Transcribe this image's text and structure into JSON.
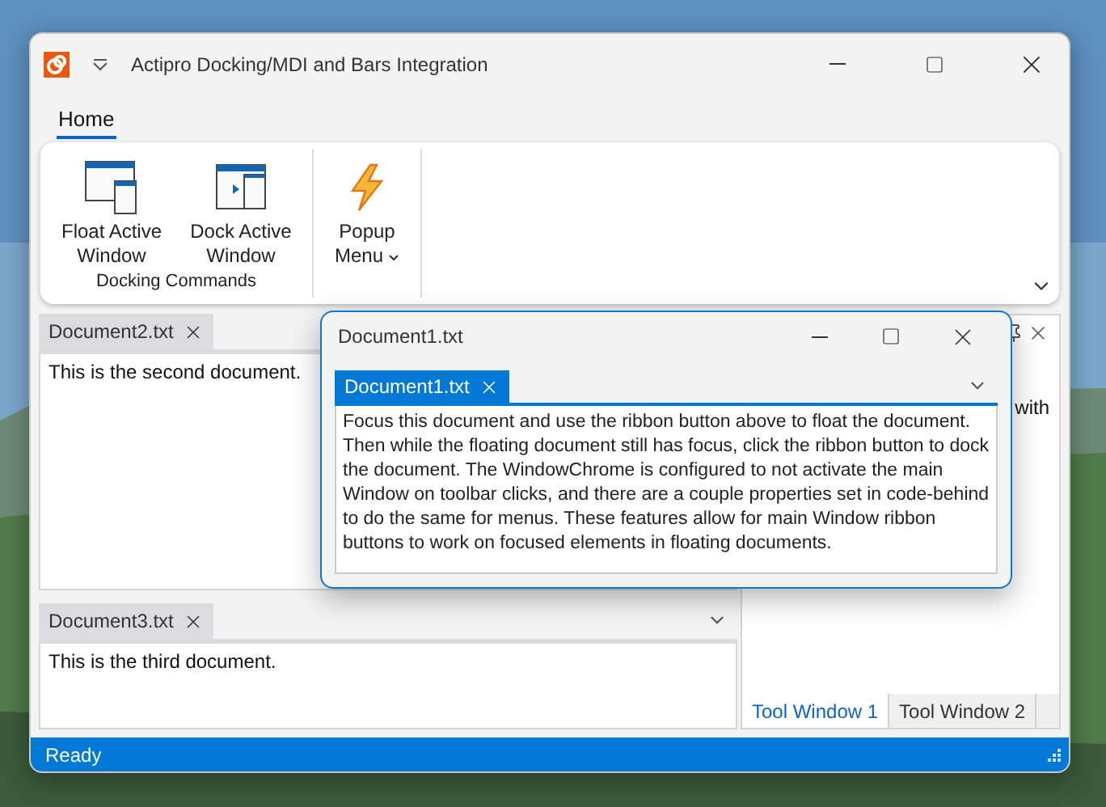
{
  "window": {
    "title": "Actipro Docking/MDI and Bars Integration"
  },
  "ribbon": {
    "tabs": [
      {
        "label": "Home",
        "selected": true
      }
    ],
    "groups": [
      {
        "label": "Docking Commands",
        "buttons": [
          {
            "label": "Float Active Window",
            "kind": "float",
            "dropdown": false
          },
          {
            "label": "Dock Active Window",
            "kind": "dock",
            "dropdown": false
          }
        ]
      },
      {
        "buttons": [
          {
            "label": "Popup Menu",
            "kind": "popup",
            "dropdown": true
          }
        ]
      }
    ]
  },
  "document_panes": [
    {
      "tabs": [
        {
          "label": "Document2.txt",
          "selected": true
        }
      ],
      "text": "This is the second document.",
      "menu": false
    },
    {
      "tabs": [
        {
          "label": "Document3.txt",
          "selected": true
        }
      ],
      "text": "This is the third document.",
      "menu": true
    }
  ],
  "tool_window": {
    "text": "with",
    "tabs": [
      {
        "label": "Tool Window 1",
        "selected": true
      },
      {
        "label": "Tool Window 2",
        "selected": false
      }
    ]
  },
  "floating_window": {
    "title": "Document1.txt",
    "tabs": [
      {
        "label": "Document1.txt",
        "selected": true
      }
    ],
    "text": "Focus this document and use the ribbon button above to float the document.  Then while the floating document still has focus, click the ribbon button to dock the document.  The WindowChrome is configured to not activate the main Window on toolbar clicks, and there are a couple properties set in code-behind to do the same for menus.  These features allow for main Window ribbon buttons to work on focused elements in floating documents."
  },
  "status_bar": {
    "text": "Ready"
  }
}
